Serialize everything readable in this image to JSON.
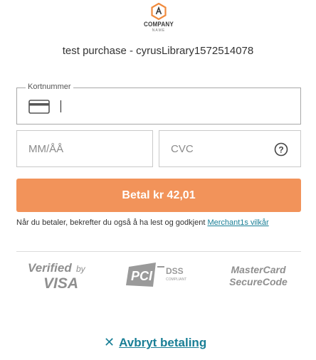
{
  "logo": {
    "name": "COMPANY",
    "sub": "NAME"
  },
  "description": "test purchase - cyrusLibrary1572514078",
  "card": {
    "label": "Kortnummer",
    "value": ""
  },
  "expiry": {
    "placeholder": "MM/ÅÅ"
  },
  "cvc": {
    "placeholder": "CVC"
  },
  "pay_button": {
    "label": "Betal kr 42,01"
  },
  "terms": {
    "text": "Når du betaler, bekrefter du også å ha lest og godkjent ",
    "link": "Merchant1s vilkår"
  },
  "badges": {
    "visa": {
      "line1": "Verified",
      "by": "by",
      "line2": "VISA"
    },
    "pci": {
      "mark": "PCI",
      "dss": "DSS",
      "compliant": "COMPLIANT"
    },
    "mastercard": {
      "line1": "MasterCard",
      "line2": "SecureCode"
    }
  },
  "cancel": {
    "label": "Avbryt betaling"
  },
  "colors": {
    "accent": "#f2935a",
    "link": "#1a7f96",
    "logo": "#f08a3c"
  }
}
